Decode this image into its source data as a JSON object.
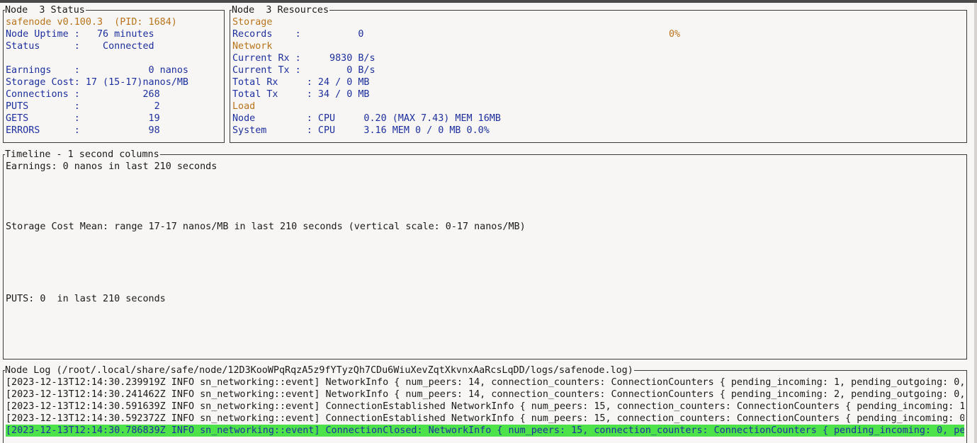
{
  "status_panel": {
    "title": "Node  3 Status",
    "version": "safenode v0.100.3  (PID: 1684)",
    "uptime": "Node Uptime :   76 minutes",
    "status": "Status      :    Connected",
    "earnings": "Earnings    :            0 nanos",
    "storage_cost": "Storage Cost: 17 (15-17)nanos/MB",
    "connections": "Connections :           268",
    "puts": "PUTS        :             2",
    "gets": "GETS        :            19",
    "errors": "ERRORS      :            98"
  },
  "resources_panel": {
    "title": "Node  3 Resources",
    "storage_heading": "Storage",
    "records": "Records    :          0",
    "records_pct": "0%",
    "network_heading": "Network",
    "current_rx": "Current Rx :     9830 B/s",
    "current_tx": "Current Tx :        0 B/s",
    "total_rx": "Total Rx     : 24 / 0 MB",
    "total_tx": "Total Tx     : 34 / 0 MB",
    "load_heading": "Load",
    "node_load": "Node         : CPU     0.20 (MAX 7.43) MEM 16MB",
    "system_load": "System       : CPU     3.16 MEM 0 / 0 MB 0.0%"
  },
  "timeline_panel": {
    "title": "Timeline - 1 second columns",
    "earnings": "Earnings: 0 nanos in last 210 seconds",
    "storage_cost": "Storage Cost Mean: range 17-17 nanos/MB in last 210 seconds (vertical scale: 0-17 nanos/MB)",
    "puts": "PUTS: 0  in last 210 seconds"
  },
  "log_panel": {
    "title": "Node Log (/root/.local/share/safe/node/12D3KooWPqRqzA5z9fYTyzQh7CDu6WiuXevZqtXkvnxAaRcsLqDD/logs/safenode.log)",
    "lines": [
      "[2023-12-13T12:14:30.239919Z INFO sn_networking::event] NetworkInfo { num_peers: 14, connection_counters: ConnectionCounters { pending_incoming: 1, pending_outgoing: 0,",
      "[2023-12-13T12:14:30.241462Z INFO sn_networking::event] NetworkInfo { num_peers: 14, connection_counters: ConnectionCounters { pending_incoming: 2, pending_outgoing: 0,",
      "[2023-12-13T12:14:30.591639Z INFO sn_networking::event] ConnectionEstablished NetworkInfo { num_peers: 15, connection_counters: ConnectionCounters { pending_incoming: 1,",
      "[2023-12-13T12:14:30.592372Z INFO sn_networking::event] ConnectionEstablished NetworkInfo { num_peers: 15, connection_counters: ConnectionCounters { pending_incoming: 0,",
      "[2023-12-13T12:14:30.786839Z INFO sn_networking::event] ConnectionClosed: NetworkInfo { num_peers: 15, connection_counters: ConnectionCounters { pending_incoming: 0, pen"
    ]
  },
  "colors": {
    "background": "#f8f6f4",
    "value_text": "#1c2f9e",
    "heading_text": "#b8731a",
    "highlight": "#4ee24a"
  }
}
